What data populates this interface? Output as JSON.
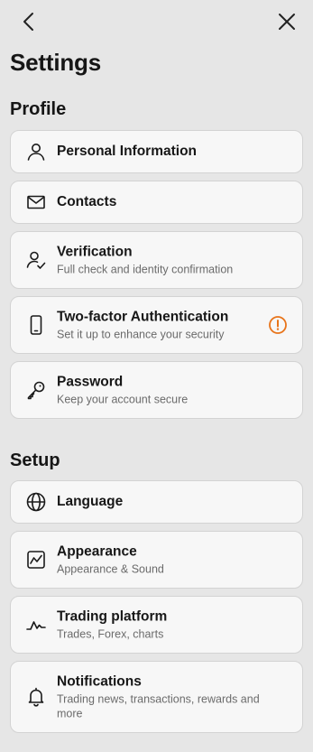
{
  "header": {
    "title": "Settings",
    "back_icon": "chevron-left-icon",
    "close_icon": "close-icon"
  },
  "sections": [
    {
      "title": "Profile",
      "items": [
        {
          "label": "Personal Information",
          "icon": "user-icon"
        },
        {
          "label": "Contacts",
          "icon": "mail-icon"
        },
        {
          "label": "Verification",
          "subtitle": "Full check and identity confirmation",
          "icon": "user-check-icon"
        },
        {
          "label": "Two-factor Authentication",
          "subtitle": "Set it up to enhance your security",
          "icon": "smartphone-icon",
          "badge": "warning-icon"
        },
        {
          "label": "Password",
          "subtitle": "Keep your account secure",
          "icon": "key-icon"
        }
      ]
    },
    {
      "title": "Setup",
      "items": [
        {
          "label": "Language",
          "icon": "globe-icon"
        },
        {
          "label": "Appearance",
          "subtitle": "Appearance & Sound",
          "icon": "chart-frame-icon"
        },
        {
          "label": "Trading platform",
          "subtitle": "Trades, Forex, charts",
          "icon": "line-chart-icon"
        },
        {
          "label": "Notifications",
          "subtitle": "Trading news, transactions, rewards and more",
          "icon": "bell-icon"
        }
      ]
    }
  ],
  "colors": {
    "background": "#e6e6e6",
    "card": "#f7f7f7",
    "card_border": "#d3d3d3",
    "warning": "#e8741a",
    "text": "#171717",
    "subtext": "#6b6b6b"
  }
}
